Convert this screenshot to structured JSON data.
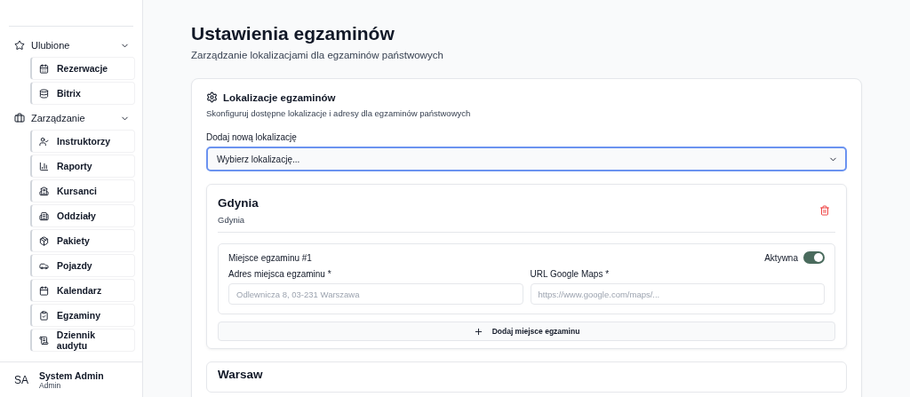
{
  "sidebar": {
    "groups": [
      {
        "label": "Ulubione",
        "expanded": true,
        "children": [
          {
            "label": "Rezerwacje"
          },
          {
            "label": "Bitrix"
          }
        ]
      },
      {
        "label": "Zarządzanie",
        "expanded": true,
        "children": [
          {
            "label": "Instruktorzy"
          },
          {
            "label": "Raporty"
          },
          {
            "label": "Kursanci"
          },
          {
            "label": "Oddziały"
          },
          {
            "label": "Pakiety"
          },
          {
            "label": "Pojazdy"
          },
          {
            "label": "Kalendarz"
          },
          {
            "label": "Egzaminy"
          },
          {
            "label": "Dziennik audytu"
          }
        ]
      }
    ],
    "user": {
      "initials": "SA",
      "name": "System Admin",
      "role": "Admin"
    }
  },
  "page": {
    "title": "Ustawienia egzaminów",
    "subtitle": "Zarządzanie lokalizacjami dla egzaminów państwowych"
  },
  "panel": {
    "title": "Lokalizacje egzaminów",
    "description": "Skonfiguruj dostępne lokalizacje i adresy dla egzaminów państwowych",
    "select_label": "Dodaj nową lokalizację",
    "select_value": "Wybierz lokalizację...",
    "locations": [
      {
        "name": "Gdynia",
        "subtitle": "Gdynia",
        "places": [
          {
            "title": "Miejsce egzaminu #1",
            "active_label": "Aktywna",
            "active": true,
            "address_label": "Adres miejsca egzaminu *",
            "address_placeholder": "Odlewnicza 8, 03-231 Warszawa",
            "url_label": "URL Google Maps *",
            "url_placeholder": "https://www.google.com/maps/..."
          }
        ],
        "add_label": "Dodaj miejsce egzaminu"
      },
      {
        "name": "Warsaw"
      }
    ]
  }
}
